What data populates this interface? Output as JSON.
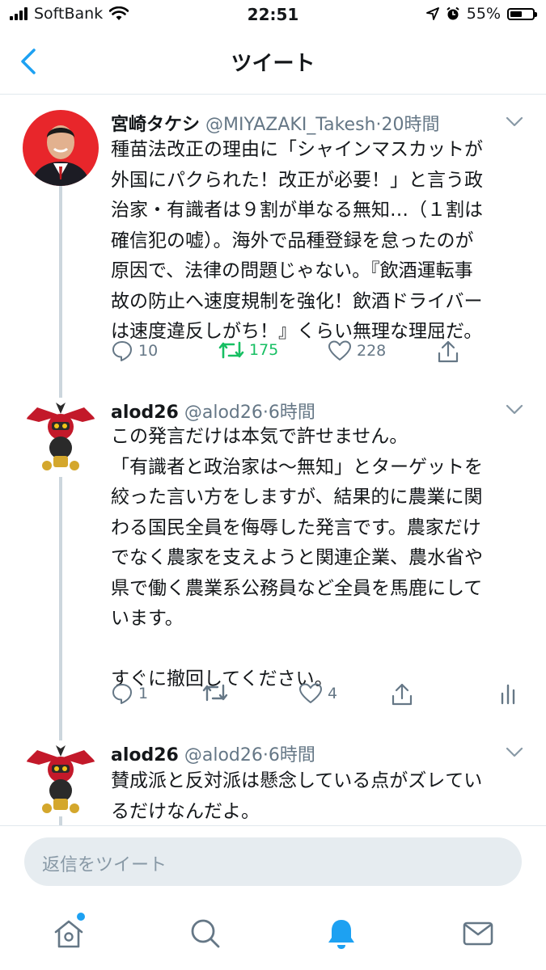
{
  "status_bar": {
    "carrier": "SoftBank",
    "time": "22:51",
    "battery_percent": "55%",
    "battery_level": 0.55
  },
  "header": {
    "title": "ツイート",
    "back_icon": "chevron-left-icon"
  },
  "tweets": [
    {
      "name": "宮崎タケシ",
      "handle": "@MIYAZAKI_Takesh",
      "time": "20時間",
      "text": "種苗法改正の理由に「シャインマスカットが\n外国にパクられた！改正が必要！」と言う政\n治家・有識者は９割が単なる無知…（１割は\n確信犯の嘘）。海外で品種登録を怠ったのが\n原因で、法律の問題じゃない。『飲酒運転事\n故の防止へ速度規制を強化！飲酒ドライバー\nは速度違反しがち！』くらい無理な理屈だ。",
      "replies": "10",
      "retweets": "175",
      "likes": "228"
    },
    {
      "name": "alod26",
      "handle": "@alod26",
      "time": "6時間",
      "text": "この発言だけは本気で許せません。\n「有識者と政治家は〜無知」とターゲットを\n絞った言い方をしますが、結果的に農業に関\nわる国民全員を侮辱した発言です。農家だけ\nでなく農家を支えようと関連企業、農水省や\n県で働く農業系公務員など全員を馬鹿にして\nいます。\n\nすぐに撤回してください。",
      "replies": "1",
      "retweets": "",
      "likes": "4"
    },
    {
      "name": "alod26",
      "handle": "@alod26",
      "time": "6時間",
      "text": "賛成派と反対派は懸念している点がズレてい\nるだけなんだよ。"
    }
  ],
  "reply_input": {
    "placeholder": "返信をツイート"
  },
  "tab_bar": {
    "items": [
      "home-icon",
      "search-icon",
      "notifications-icon",
      "messages-icon"
    ],
    "active": "notifications-icon"
  },
  "colors": {
    "accent": "#1da1f2",
    "retweet_green": "#17bf63",
    "meta_gray": "#657786",
    "reply_box_bg": "#e6ecf0"
  }
}
